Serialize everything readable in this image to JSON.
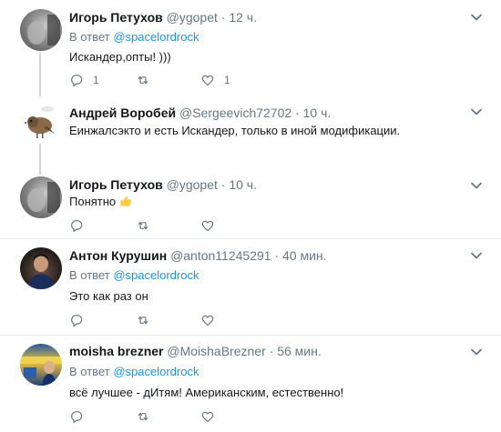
{
  "tweets": [
    {
      "author": "Игорь Петухов",
      "handle": "@ygopet",
      "time": "12 ч.",
      "reply_prefix": "В ответ",
      "reply_to": "@spacelordrock",
      "text": "Искандер,опты! )))",
      "replies": "1",
      "retweets": "",
      "likes": "1"
    },
    {
      "author": "Андрей Воробей",
      "handle": "@Sergeevich72702",
      "time": "10 ч.",
      "text": "Еинжалсэкто и есть Искандер, только в иной модификации."
    },
    {
      "author": "Игорь Петухов",
      "handle": "@ygopet",
      "time": "10 ч.",
      "text": "Понятно"
    },
    {
      "author": "Антон Курушин",
      "handle": "@anton11245291",
      "time": "40 мин.",
      "reply_prefix": "В ответ",
      "reply_to": "@spacelordrock",
      "text": "Это как раз он"
    },
    {
      "author": "moisha brezner",
      "handle": "@MoishaBrezner",
      "time": "56 мин.",
      "reply_prefix": "В ответ",
      "reply_to": "@spacelordrock",
      "text": "всё лучшее - дИтям! Американским, естественно!"
    }
  ],
  "separator": " · ",
  "icons": {
    "reply": "reply-icon",
    "retweet": "retweet-icon",
    "like": "heart-icon",
    "menu": "chevron-down-icon",
    "emoji": "thumbs-up-icon"
  },
  "colors": {
    "link": "#1b95e0",
    "muted": "#657786",
    "text": "#14171a",
    "thread": "#ccd6dd",
    "emoji": "#ffc83d"
  }
}
